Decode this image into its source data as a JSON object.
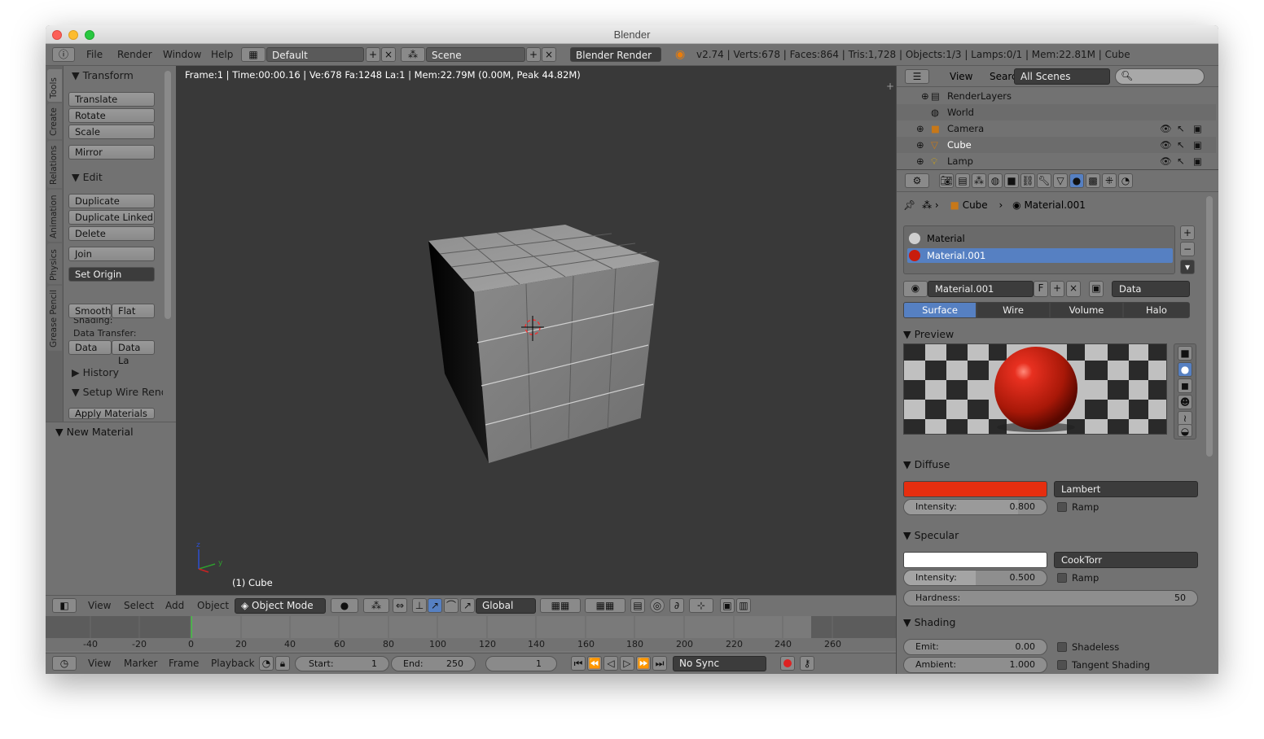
{
  "window": {
    "title": "Blender"
  },
  "infobar": {
    "menus": [
      "File",
      "Render",
      "Window",
      "Help"
    ],
    "layout": "Default",
    "scene": "Scene",
    "engine": "Blender Render",
    "stats": "v2.74 | Verts:678 | Faces:864 | Tris:1,728 | Objects:1/3 | Lamps:0/1 | Mem:22.81M | Cube"
  },
  "viewport": {
    "info": "Frame:1 | Time:00:00.16 | Ve:678 Fa:1248 La:1 | Mem:22.79M (0.00M, Peak 44.82M)",
    "object_label": "(1) Cube",
    "header": {
      "menus": [
        "View",
        "Select",
        "Add",
        "Object"
      ],
      "mode": "Object Mode",
      "orientation": "Global"
    }
  },
  "toolshelf": {
    "tabs": [
      "Tools",
      "Create",
      "Relations",
      "Animation",
      "Physics",
      "Grease Pencil"
    ],
    "transform_header": "Transform",
    "transform_buttons": [
      "Translate",
      "Rotate",
      "Scale"
    ],
    "mirror": "Mirror",
    "edit_header": "Edit",
    "edit_buttons": [
      "Duplicate",
      "Duplicate Linked",
      "Delete"
    ],
    "join": "Join",
    "set_origin": "Set Origin",
    "shading_label": "Shading:",
    "smooth": "Smooth",
    "flat": "Flat",
    "data_transfer_label": "Data Transfer:",
    "data": "Data",
    "data_la": "Data La",
    "history": "History",
    "setup_wire": "Setup Wire Rend",
    "apply_materials": "Apply Materials",
    "new_material": "New Material"
  },
  "timeline": {
    "menus": [
      "View",
      "Marker",
      "Frame",
      "Playback"
    ],
    "start_label": "Start:",
    "start": "1",
    "end_label": "End:",
    "end": "250",
    "current": "1",
    "sync": "No Sync",
    "ticks": [
      "-40",
      "-20",
      "0",
      "20",
      "40",
      "60",
      "80",
      "100",
      "120",
      "140",
      "160",
      "180",
      "200",
      "220",
      "240",
      "260"
    ]
  },
  "outliner": {
    "menus": [
      "View",
      "Search"
    ],
    "filter": "All Scenes",
    "items": [
      "RenderLayers",
      "World",
      "Camera",
      "Cube",
      "Lamp"
    ]
  },
  "properties": {
    "breadcrumb": [
      "Cube",
      "Material.001"
    ],
    "slots": [
      "Material",
      "Material.001"
    ],
    "material_name": "Material.001",
    "fake_user": "F",
    "link": "Data",
    "types": [
      "Surface",
      "Wire",
      "Volume",
      "Halo"
    ],
    "preview_header": "Preview",
    "diffuse_header": "Diffuse",
    "diffuse_color": "#e62e0f",
    "diffuse_shader": "Lambert",
    "diffuse_intensity_label": "Intensity:",
    "diffuse_intensity": "0.800",
    "diffuse_intensity_fill": 0.8,
    "ramp": "Ramp",
    "specular_header": "Specular",
    "specular_color": "#ffffff",
    "specular_shader": "CookTorr",
    "specular_intensity_label": "Intensity:",
    "specular_intensity": "0.500",
    "specular_intensity_fill": 0.5,
    "hardness_label": "Hardness:",
    "hardness": "50",
    "shading_header": "Shading",
    "emit_label": "Emit:",
    "emit": "0.00",
    "ambient_label": "Ambient:",
    "ambient": "1.000",
    "shadeless": "Shadeless",
    "tangent_shading": "Tangent Shading"
  }
}
